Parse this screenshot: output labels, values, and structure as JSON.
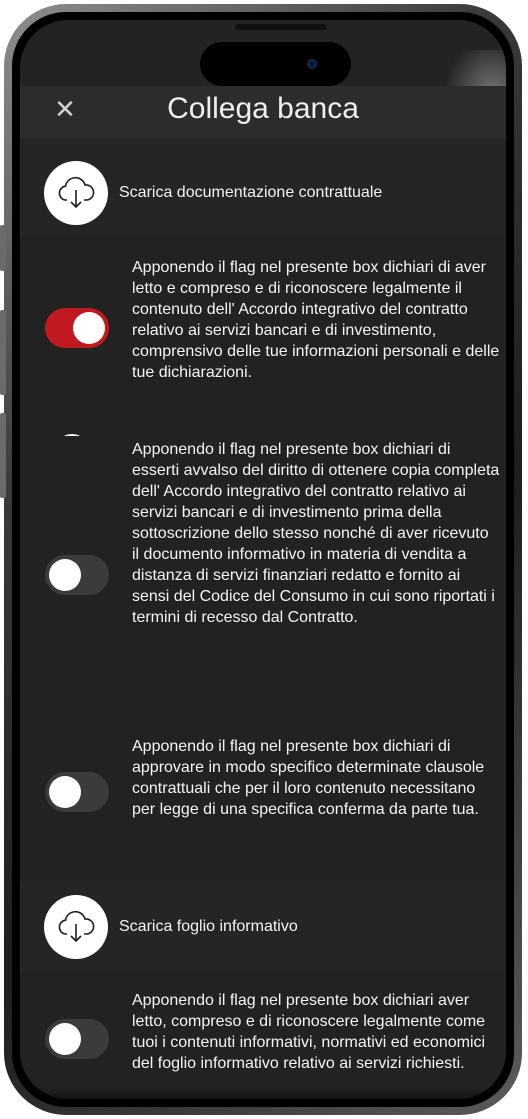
{
  "header": {
    "close_icon": "close-icon",
    "title": "Collega banca"
  },
  "sections": [
    {
      "download_label": "Scarica documentazione contrattuale",
      "icon": "cloud-download-icon",
      "consents": [
        {
          "checked": true,
          "text": "Apponendo il flag nel presente box dichiari di aver letto e compreso e di riconoscere legalmente il contenuto dell' Accordo integrativo del contratto relativo ai servizi bancari e di investimento, comprensivo delle tue informazioni personali e delle tue dichiarazioni."
        },
        {
          "checked": false,
          "text": "Apponendo il flag nel presente box dichiari di esserti avvalso del diritto di ottenere copia completa dell' Accordo integrativo del contratto relativo ai servizi bancari e di investimento prima della sottoscrizione dello stesso nonché di aver ricevuto il documento informativo in materia di vendita a distanza di servizi finanziari redatto e fornito ai sensi del Codice del Consumo in cui sono riportati i termini di recesso dal Contratto."
        },
        {
          "checked": false,
          "text": "Apponendo il flag nel presente box dichiari di approvare in modo specifico determinate clausole contrattuali che per il loro contenuto necessitano per legge di una specifica conferma da parte tua."
        }
      ]
    },
    {
      "download_label": "Scarica foglio informativo",
      "icon": "cloud-download-icon",
      "consents": [
        {
          "checked": false,
          "text": "Apponendo il flag nel presente box dichiari aver letto, compreso e di riconoscere legalmente come tuoi i contenuti informativi, normativi ed economici del foglio informativo relativo ai servizi richiesti."
        }
      ]
    }
  ],
  "colors": {
    "toggle_on": "#c01a20",
    "toggle_off": "#3b3b3b",
    "background": "#232323"
  }
}
